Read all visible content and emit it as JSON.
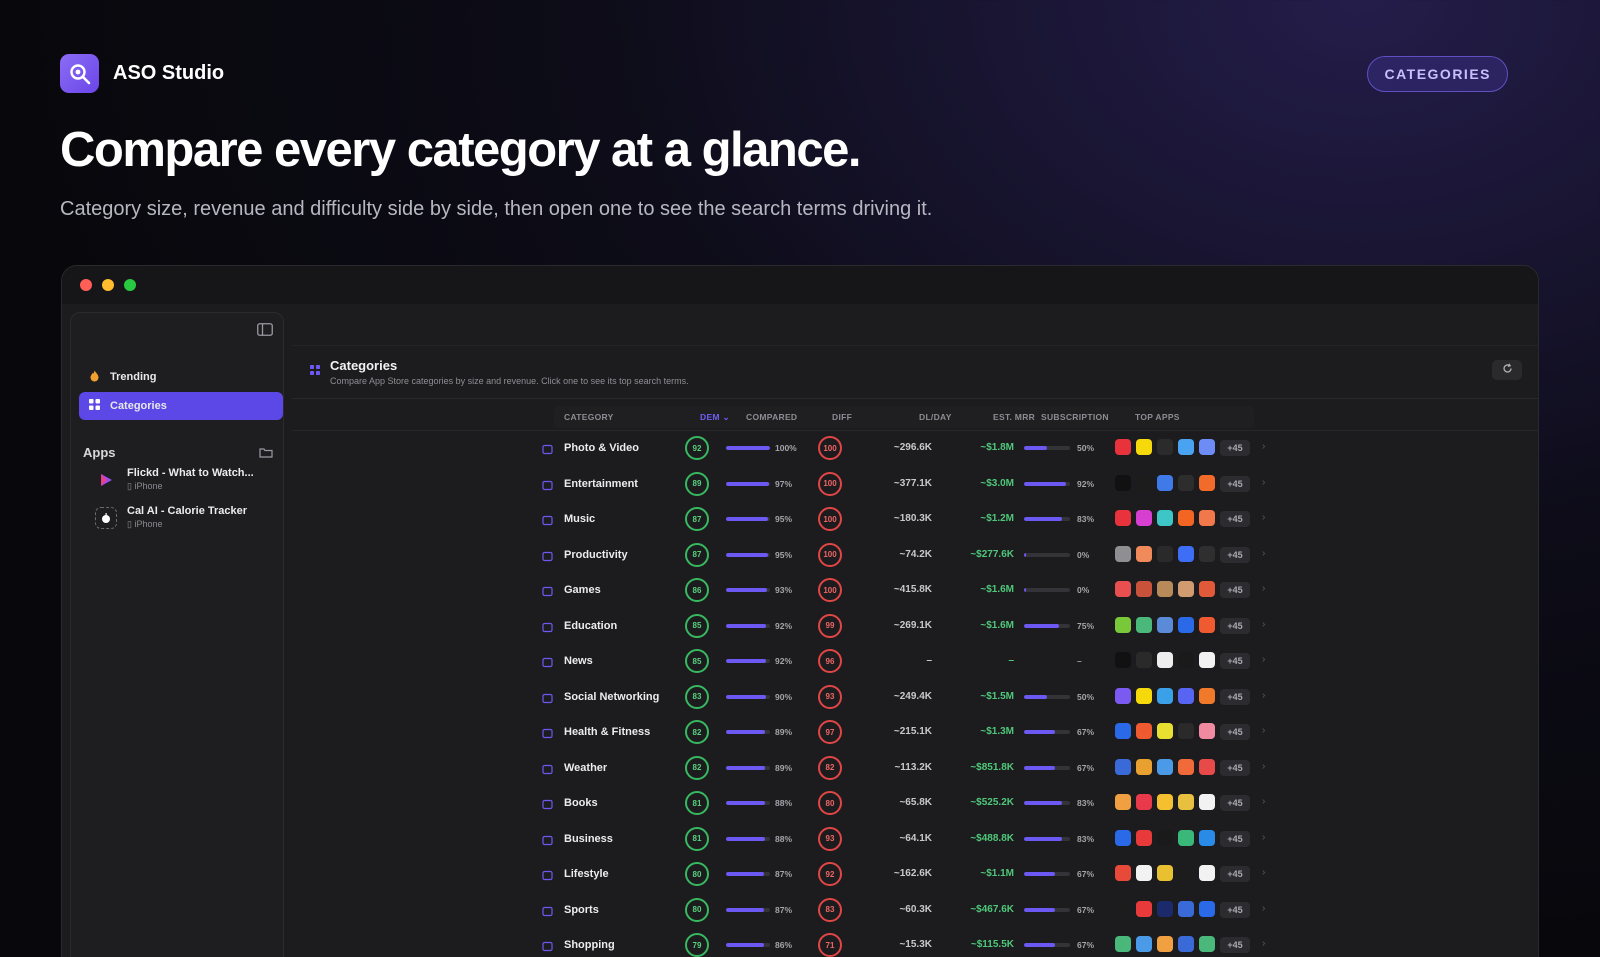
{
  "brand": {
    "name": "ASO Studio"
  },
  "header_pill": "CATEGORIES",
  "hero": {
    "title": "Compare every category at a glance.",
    "subtitle": "Category size, revenue and difficulty side by side, then open one to see the search terms driving it."
  },
  "sidebar": {
    "nav": [
      {
        "label": "Trending",
        "icon": "flame-icon"
      },
      {
        "label": "Categories",
        "icon": "grid-icon",
        "active": true
      }
    ],
    "apps_section": "Apps",
    "apps": [
      {
        "name": "Flickd - What to Watch...",
        "platform": "iPhone",
        "color": "#8a3cf0"
      },
      {
        "name": "Cal AI - Calorie Tracker",
        "platform": "iPhone",
        "color": "#1a1a1a"
      }
    ]
  },
  "page": {
    "title": "Categories",
    "description": "Compare App Store categories by size and revenue. Click one to see its top search terms."
  },
  "table": {
    "columns": {
      "category": "CATEGORY",
      "dem": "DEM",
      "compared": "COMPARED",
      "diff": "DIFF",
      "dlday": "DL/DAY",
      "mrr": "EST. MRR",
      "subscription": "SUBSCRIPTION",
      "top_apps": "TOP APPS"
    },
    "rows": [
      {
        "name": "Photo & Video",
        "dem": "92",
        "compared": 100,
        "compared_label": "100%",
        "diff": "100",
        "dl": "~296.6K",
        "mrr": "~$1.8M",
        "sub": 50,
        "sub_label": "50%",
        "more": "+45",
        "app_colors": [
          "#e8323c",
          "#f5d90a",
          "#2b2b2b",
          "#4aa3f0",
          "#6d8cf5"
        ]
      },
      {
        "name": "Entertainment",
        "dem": "89",
        "compared": 97,
        "compared_label": "97%",
        "diff": "100",
        "dl": "~377.1K",
        "mrr": "~$3.0M",
        "sub": 92,
        "sub_label": "92%",
        "more": "+45",
        "app_colors": [
          "#111111",
          "#1c1c1c",
          "#3f7ae8",
          "#2d2d2d",
          "#f26b2b"
        ]
      },
      {
        "name": "Music",
        "dem": "87",
        "compared": 95,
        "compared_label": "95%",
        "diff": "100",
        "dl": "~180.3K",
        "mrr": "~$1.2M",
        "sub": 83,
        "sub_label": "83%",
        "more": "+45",
        "app_colors": [
          "#e8323c",
          "#d73fd0",
          "#3ec6c6",
          "#f26522",
          "#f0784a"
        ]
      },
      {
        "name": "Productivity",
        "dem": "87",
        "compared": 95,
        "compared_label": "95%",
        "diff": "100",
        "dl": "~74.2K",
        "mrr": "~$277.6K",
        "sub": 4,
        "sub_label": "0%",
        "more": "+45",
        "app_colors": [
          "#8e8e93",
          "#f08a5a",
          "#2a2a2a",
          "#3d6ef5",
          "#2f2f2f"
        ]
      },
      {
        "name": "Games",
        "dem": "86",
        "compared": 93,
        "compared_label": "93%",
        "diff": "100",
        "dl": "~415.8K",
        "mrr": "~$1.6M",
        "sub": 4,
        "sub_label": "0%",
        "more": "+45",
        "app_colors": [
          "#e84f4f",
          "#c8523a",
          "#b88a5a",
          "#d09b70",
          "#e05a3a"
        ]
      },
      {
        "name": "Education",
        "dem": "85",
        "compared": 92,
        "compared_label": "92%",
        "diff": "99",
        "dl": "~269.1K",
        "mrr": "~$1.6M",
        "sub": 75,
        "sub_label": "75%",
        "more": "+45",
        "app_colors": [
          "#78c83a",
          "#4ab87a",
          "#5a8ad8",
          "#2a6ae8",
          "#f05a30"
        ]
      },
      {
        "name": "News",
        "dem": "85",
        "compared": 92,
        "compared_label": "92%",
        "diff": "96",
        "dl": "–",
        "mrr": "–",
        "sub": 0,
        "sub_label": "–",
        "more": "+45",
        "app_colors": [
          "#111111",
          "#2a2a2a",
          "#eeeeee",
          "#1a1a1a",
          "#f2f2f2"
        ]
      },
      {
        "name": "Social Networking",
        "dem": "83",
        "compared": 90,
        "compared_label": "90%",
        "diff": "93",
        "dl": "~249.4K",
        "mrr": "~$1.5M",
        "sub": 50,
        "sub_label": "50%",
        "more": "+45",
        "app_colors": [
          "#7a5af0",
          "#f5d90a",
          "#3aa0e8",
          "#5865f2",
          "#f07a2a"
        ]
      },
      {
        "name": "Health & Fitness",
        "dem": "82",
        "compared": 89,
        "compared_label": "89%",
        "diff": "97",
        "dl": "~215.1K",
        "mrr": "~$1.3M",
        "sub": 67,
        "sub_label": "67%",
        "more": "+45",
        "app_colors": [
          "#2a6ae8",
          "#f05a30",
          "#e8e030",
          "#2a2a2a",
          "#f08aa0"
        ]
      },
      {
        "name": "Weather",
        "dem": "82",
        "compared": 89,
        "compared_label": "89%",
        "diff": "82",
        "dl": "~113.2K",
        "mrr": "~$851.8K",
        "sub": 67,
        "sub_label": "67%",
        "more": "+45",
        "app_colors": [
          "#3a6ad8",
          "#e8a030",
          "#4a9ae8",
          "#f06a3a",
          "#e84a4a"
        ]
      },
      {
        "name": "Books",
        "dem": "81",
        "compared": 88,
        "compared_label": "88%",
        "diff": "80",
        "dl": "~65.8K",
        "mrr": "~$525.2K",
        "sub": 83,
        "sub_label": "83%",
        "more": "+45",
        "app_colors": [
          "#f0a040",
          "#e83a4a",
          "#f5c030",
          "#e8c040",
          "#f2f2f2"
        ]
      },
      {
        "name": "Business",
        "dem": "81",
        "compared": 88,
        "compared_label": "88%",
        "diff": "93",
        "dl": "~64.1K",
        "mrr": "~$488.8K",
        "sub": 83,
        "sub_label": "83%",
        "more": "+45",
        "app_colors": [
          "#2a6ae8",
          "#e83a3a",
          "#1a1a1a",
          "#3ab87a",
          "#2a8ae8"
        ]
      },
      {
        "name": "Lifestyle",
        "dem": "80",
        "compared": 87,
        "compared_label": "87%",
        "diff": "92",
        "dl": "~162.6K",
        "mrr": "~$1.1M",
        "sub": 67,
        "sub_label": "67%",
        "more": "+45",
        "app_colors": [
          "#e84a3a",
          "#f2f2f2",
          "#e8c030",
          "#1c1c1c",
          "#f2f2f2"
        ]
      },
      {
        "name": "Sports",
        "dem": "80",
        "compared": 87,
        "compared_label": "87%",
        "diff": "83",
        "dl": "~60.3K",
        "mrr": "~$467.6K",
        "sub": 67,
        "sub_label": "67%",
        "more": "+45",
        "app_colors": [
          "#1c1c1c",
          "#e83a3a",
          "#1a2a6a",
          "#3a6ad8",
          "#2a6ae8"
        ]
      },
      {
        "name": "Shopping",
        "dem": "79",
        "compared": 86,
        "compared_label": "86%",
        "diff": "71",
        "dl": "~15.3K",
        "mrr": "~$115.5K",
        "sub": 67,
        "sub_label": "67%",
        "more": "+45",
        "app_colors": [
          "#4ab87a",
          "#4a9ae8",
          "#f0a040",
          "#3a6ad8",
          "#4ab87a"
        ]
      }
    ]
  },
  "colors": {
    "accent": "#5b48e6",
    "green": "#4fc77a",
    "red": "#e04646"
  }
}
